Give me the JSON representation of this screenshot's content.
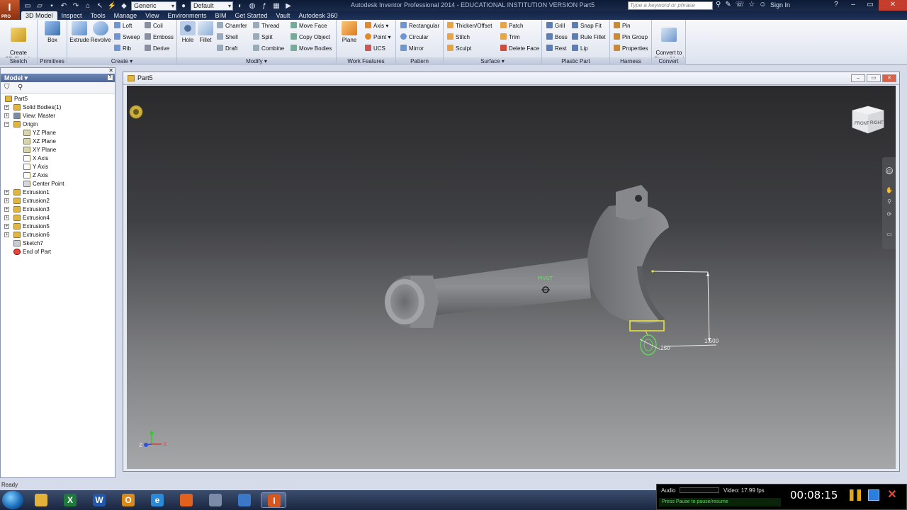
{
  "titlebar": {
    "app_logo": "I",
    "app_logo_sub": "PRO",
    "material_combo": "Generic",
    "appearance_combo": "Default",
    "window_title": "Autodesk Inventor Professional 2014 - EDUCATIONAL INSTITUTION VERSION    Part5",
    "search_placeholder": "Type a keyword or phrase",
    "sign_in": "Sign In"
  },
  "tabs": [
    {
      "label": "3D Model"
    },
    {
      "label": "Inspect"
    },
    {
      "label": "Tools"
    },
    {
      "label": "Manage"
    },
    {
      "label": "View"
    },
    {
      "label": "Environments"
    },
    {
      "label": "BIM"
    },
    {
      "label": "Get Started"
    },
    {
      "label": "Vault"
    },
    {
      "label": "Autodesk 360"
    }
  ],
  "ribbon": {
    "sketch": {
      "title": "Sketch",
      "create_2d_sketch": "Create\n2D Sketch"
    },
    "primitives": {
      "title": "Primitives",
      "box": "Box"
    },
    "create": {
      "title": "Create",
      "extrude": "Extrude",
      "revolve": "Revolve",
      "loft": "Loft",
      "sweep": "Sweep",
      "rib": "Rib",
      "coil": "Coil",
      "emboss": "Emboss",
      "derive": "Derive"
    },
    "modify": {
      "title": "Modify",
      "hole": "Hole",
      "fillet": "Fillet",
      "chamfer": "Chamfer",
      "shell": "Shell",
      "draft": "Draft",
      "thread": "Thread",
      "split": "Split",
      "combine": "Combine",
      "move_face": "Move Face",
      "copy_object": "Copy Object",
      "move_bodies": "Move Bodies"
    },
    "work_features": {
      "title": "Work Features",
      "plane": "Plane",
      "axis": "Axis",
      "point": "Point",
      "ucs": "UCS"
    },
    "pattern": {
      "title": "Pattern",
      "rectangular": "Rectangular",
      "circular": "Circular",
      "mirror": "Mirror"
    },
    "surface": {
      "title": "Surface",
      "thicken_offset": "Thicken/Offset",
      "stitch": "Stitch",
      "sculpt": "Sculpt",
      "patch": "Patch",
      "trim": "Trim",
      "delete_face": "Delete Face"
    },
    "plastic_part": {
      "title": "Plastic Part",
      "grill": "Grill",
      "boss": "Boss",
      "rest": "Rest",
      "snap_fit": "Snap Fit",
      "rule_fillet": "Rule Fillet",
      "lip": "Lip"
    },
    "harness": {
      "title": "Harness",
      "pin": "Pin",
      "pin_group": "Pin Group",
      "properties": "Properties"
    },
    "convert": {
      "title": "Convert",
      "convert_to_sheet_metal": "Convert to\nSheet Metal"
    }
  },
  "model_browser": {
    "header": "Model ▾",
    "items": [
      {
        "label": "Part5"
      },
      {
        "label": "Solid Bodies(1)"
      },
      {
        "label": "View: Master"
      },
      {
        "label": "Origin"
      },
      {
        "label": "YZ Plane"
      },
      {
        "label": "XZ Plane"
      },
      {
        "label": "XY Plane"
      },
      {
        "label": "X Axis"
      },
      {
        "label": "Y Axis"
      },
      {
        "label": "Z Axis"
      },
      {
        "label": "Center Point"
      },
      {
        "label": "Extrusion1"
      },
      {
        "label": "Extrusion2"
      },
      {
        "label": "Extrusion3"
      },
      {
        "label": "Extrusion4"
      },
      {
        "label": "Extrusion5"
      },
      {
        "label": "Extrusion6"
      },
      {
        "label": "Sketch7"
      },
      {
        "label": "End of Part"
      }
    ]
  },
  "graphics_window": {
    "title": "Part5",
    "viewcube_front": "FRONT",
    "viewcube_right": "RIGHT",
    "pivot_label": "PIVOT",
    "dim_1": "1.500",
    "dim_2": ".250",
    "axis_z": "Z",
    "axis_x": "X"
  },
  "status": {
    "text": "Ready"
  },
  "recorder": {
    "audio_label": "Audio",
    "video_label": "Video: 17.99 fps",
    "hint": "Press Pause to pause/resume",
    "clock": "00:08:15"
  },
  "taskbar": {
    "items": [
      {
        "icon": "explorer-icon",
        "color": "#e3b23c"
      },
      {
        "icon": "excel-icon",
        "color": "#1f7a3c",
        "glyph": "X"
      },
      {
        "icon": "word-icon",
        "color": "#2457a8",
        "glyph": "W"
      },
      {
        "icon": "outlook-icon",
        "color": "#d88a1a",
        "glyph": "O"
      },
      {
        "icon": "ie-icon",
        "color": "#2a8ad6",
        "glyph": "e"
      },
      {
        "icon": "firefox-icon",
        "color": "#e2621d"
      },
      {
        "icon": "files-icon",
        "color": "#7b8ca8"
      },
      {
        "icon": "media-icon",
        "color": "#3b78c8"
      },
      {
        "icon": "inventor-icon",
        "color": "#d5571f",
        "glyph": "I"
      }
    ]
  },
  "colors": {
    "accent": "#4d6698",
    "sketch_highlight": "#f2e93a",
    "selection_green": "#5fd45f"
  }
}
